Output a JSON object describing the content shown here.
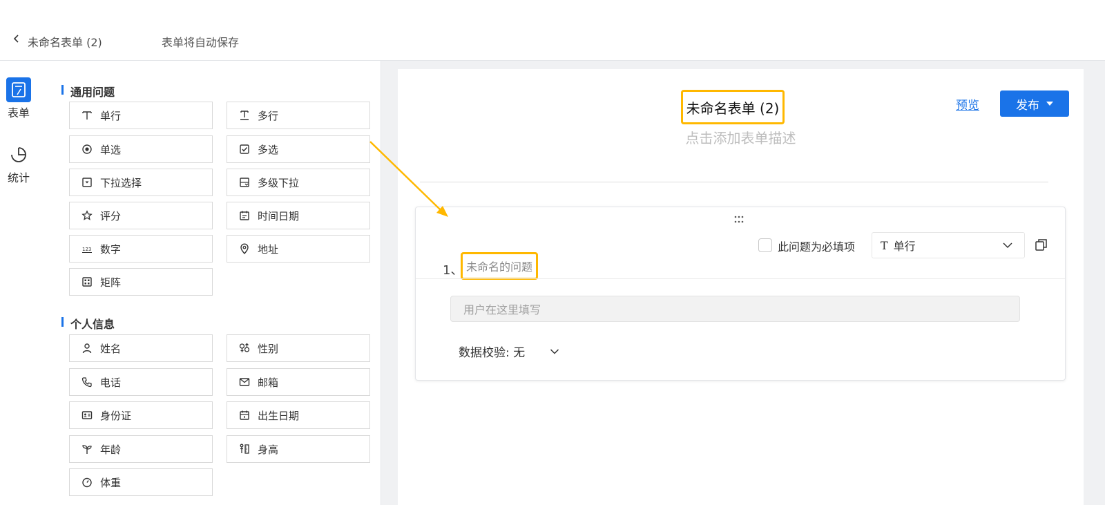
{
  "header": {
    "title": "未命名表单 (2)",
    "autosave": "表单将自动保存"
  },
  "rail": {
    "items": [
      {
        "label": "表单",
        "icon": "form-icon",
        "active": true
      },
      {
        "label": "统计",
        "icon": "chart-pie-icon",
        "active": false
      }
    ]
  },
  "palette": {
    "groups": [
      {
        "title": "通用问题",
        "items": [
          {
            "label": "单行",
            "icon": "single-line-icon"
          },
          {
            "label": "多行",
            "icon": "multi-line-icon"
          },
          {
            "label": "单选",
            "icon": "radio-icon"
          },
          {
            "label": "多选",
            "icon": "checkbox-icon"
          },
          {
            "label": "下拉选择",
            "icon": "dropdown-icon"
          },
          {
            "label": "多级下拉",
            "icon": "cascade-dropdown-icon"
          },
          {
            "label": "评分",
            "icon": "star-icon"
          },
          {
            "label": "时间日期",
            "icon": "calendar-icon"
          },
          {
            "label": "数字",
            "icon": "number-icon"
          },
          {
            "label": "地址",
            "icon": "location-pin-icon"
          },
          {
            "label": "矩阵",
            "icon": "matrix-icon"
          }
        ]
      },
      {
        "title": "个人信息",
        "items": [
          {
            "label": "姓名",
            "icon": "person-icon"
          },
          {
            "label": "性别",
            "icon": "gender-icon"
          },
          {
            "label": "电话",
            "icon": "phone-icon"
          },
          {
            "label": "邮箱",
            "icon": "mail-icon"
          },
          {
            "label": "身份证",
            "icon": "id-card-icon"
          },
          {
            "label": "出生日期",
            "icon": "birthday-icon"
          },
          {
            "label": "年龄",
            "icon": "sprout-icon"
          },
          {
            "label": "身高",
            "icon": "ruler-icon"
          },
          {
            "label": "体重",
            "icon": "scale-icon"
          }
        ]
      }
    ]
  },
  "form": {
    "title": "未命名表单 (2)",
    "description_placeholder": "点击添加表单描述",
    "preview_label": "预览",
    "publish_label": "发布"
  },
  "question": {
    "number": "1、",
    "title": "未命名的问题",
    "required_label": "此问题为必填项",
    "required": false,
    "type_icon": "T",
    "type_label": "单行",
    "answer_placeholder": "用户在这里填写",
    "validation_label": "数据校验: 无"
  },
  "colors": {
    "accent": "#1a73e8",
    "highlight": "#ffb800",
    "canvas_bg": "#f0f1f3"
  }
}
